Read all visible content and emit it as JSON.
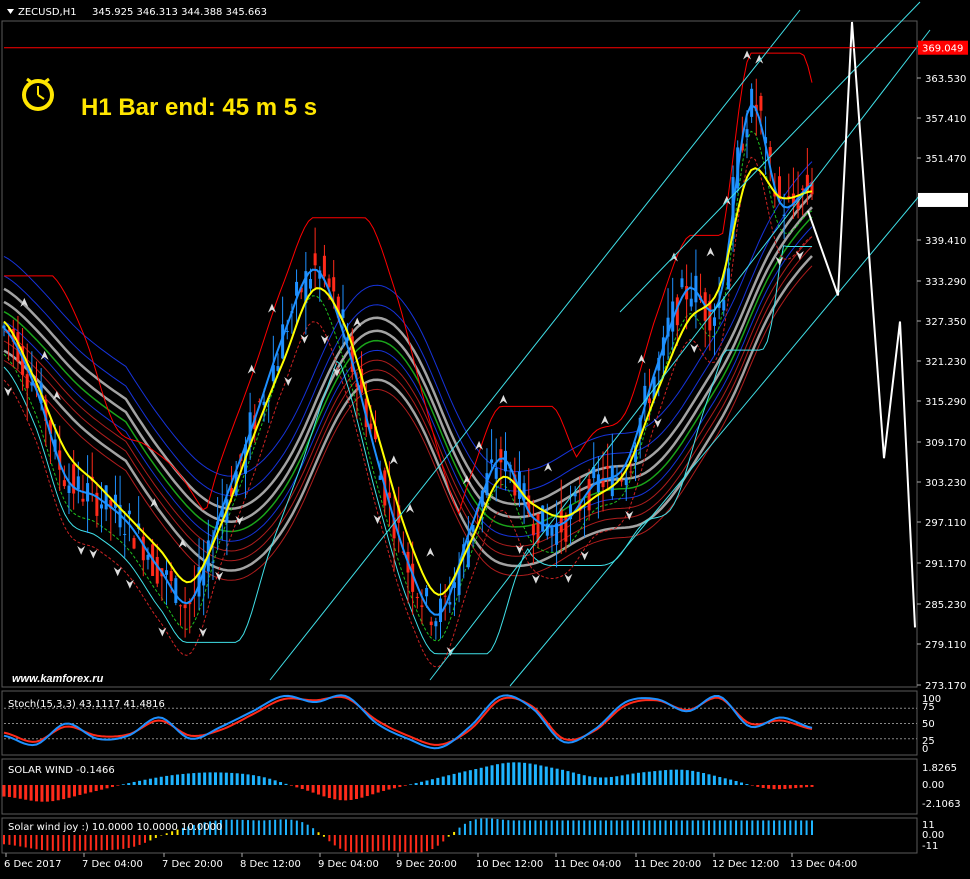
{
  "symbol_header": {
    "symbol": "ZECUSD,H1",
    "ohlc": "345.925 346.313 344.388 345.663",
    "dropdown_icon": "triangle-down-icon"
  },
  "timer": {
    "icon": "clock-icon",
    "text": "H1 Bar end: 45 m 5 s",
    "color": "#FFE600"
  },
  "watermark": "www.kamforex.ru",
  "colors": {
    "background": "#000000",
    "bull_candle": "#1E90FF",
    "bear_candle": "#FF2A1A",
    "price_line": "#1E90FF",
    "fast_ma": "#FFFF00",
    "channel_lines": "#40E0E8",
    "resistance": "#FF0000",
    "current_price_tag": "#FFFFFF",
    "stoch_main": "#1E90FF",
    "stoch_signal": "#FF2A1A",
    "histogram_pos": "#1EB4FF",
    "histogram_neg": "#FF2A1A",
    "forecast": "#FFFFFF"
  },
  "chart_data": [
    {
      "type": "line",
      "panel": "main",
      "title": "ZECUSD,H1",
      "x": [
        "6 Dec 2017",
        "7 Dec 04:00",
        "7 Dec 20:00",
        "8 Dec 12:00",
        "9 Dec 04:00",
        "9 Dec 20:00",
        "10 Dec 12:00",
        "11 Dec 04:00",
        "11 Dec 20:00",
        "12 Dec 12:00",
        "13 Dec 04:00"
      ],
      "y_ticks": [
        "363.530",
        "357.410",
        "351.470",
        "345.663",
        "339.410",
        "333.290",
        "327.350",
        "321.230",
        "315.290",
        "309.170",
        "303.230",
        "297.110",
        "291.170",
        "285.230",
        "279.110",
        "273.170"
      ],
      "ylim": [
        271.0,
        373.0
      ],
      "resistance_level": {
        "label": "369.049",
        "value": 369.049,
        "color": "#FF0000"
      },
      "current_price": {
        "label": "345.663",
        "value": 345.663
      },
      "series": [
        {
          "values": [
            326,
            317,
            303,
            300,
            296,
            289,
            284,
            298,
            311,
            325,
            335,
            324,
            306,
            290,
            282,
            295,
            306,
            297,
            296,
            302,
            305,
            320,
            332,
            330,
            360,
            345,
            348
          ]
        },
        {
          "values": [
            327,
            318,
            307,
            302,
            297,
            292,
            287,
            296,
            309,
            321,
            332,
            326,
            310,
            294,
            285,
            293,
            303,
            299,
            297,
            300,
            304,
            316,
            327,
            332,
            350,
            346,
            347
          ]
        }
      ],
      "forecast": [
        344,
        331,
        373,
        306,
        327,
        280
      ]
    },
    {
      "type": "line",
      "panel": "stochastic",
      "title": "Stoch(15,3,3) 43.1117 41.4816",
      "y_ticks": [
        "100",
        "75",
        "50",
        "25",
        "0"
      ],
      "ylim": [
        0,
        100
      ],
      "series": [
        {
          "values": [
            30,
            15,
            50,
            25,
            30,
            60,
            25,
            45,
            70,
            95,
            85,
            95,
            50,
            25,
            10,
            45,
            95,
            75,
            20,
            40,
            85,
            90,
            70,
            95,
            45,
            60,
            43
          ]
        },
        {
          "values": [
            35,
            20,
            45,
            30,
            32,
            55,
            30,
            40,
            65,
            90,
            88,
            92,
            55,
            30,
            15,
            40,
            90,
            78,
            25,
            38,
            80,
            88,
            72,
            92,
            50,
            55,
            41
          ]
        }
      ]
    },
    {
      "type": "bar",
      "panel": "solar_wind",
      "title": "SOLAR WIND -0.1466",
      "y_ticks": [
        "1.8265",
        "0.00",
        "-2.1063"
      ],
      "ylim": [
        -2.1063,
        1.8265
      ],
      "values": [
        -0.9,
        -1.3,
        -0.6,
        0.2,
        0.8,
        1.0,
        0.7,
        -0.3,
        -1.2,
        -0.4,
        0.4,
        1.2,
        1.8,
        1.3,
        0.6,
        1.0,
        1.2,
        0.5,
        -0.3,
        -0.15
      ]
    },
    {
      "type": "bar",
      "panel": "solar_wind_joy",
      "title": "Solar wind joy :) 10.0000 10.0000 10.0000",
      "y_ticks": [
        "11",
        "0.00",
        "-11"
      ],
      "ylim": [
        -11,
        11
      ],
      "values": [
        -6,
        -10,
        -10,
        -8,
        3,
        10,
        10,
        9,
        -10,
        -10,
        -10,
        10,
        10,
        10,
        10,
        10,
        10,
        10,
        10,
        10
      ]
    }
  ]
}
